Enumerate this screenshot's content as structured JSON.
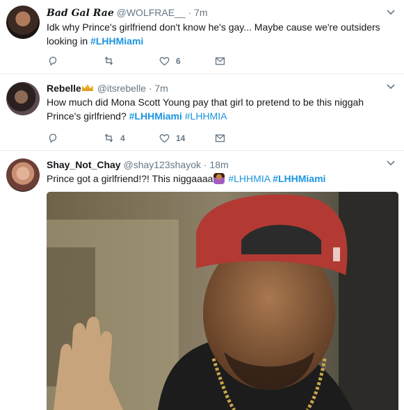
{
  "tweets": [
    {
      "name": "Bad Gal Rae",
      "handle": "@WOLFRAE__ · 7m",
      "text": [
        {
          "t": "Idk why "
        },
        {
          "t": "Prince",
          "b": true
        },
        {
          "t": "'s "
        },
        {
          "t": "girlfriend",
          "b": true
        },
        {
          "t": " don't know he's gay... Maybe cause we're outsiders looking in  "
        },
        {
          "t": "#LHHMiami",
          "tag": true,
          "b": true
        }
      ],
      "reply_count": "",
      "retweet_count": "",
      "like_count": "6"
    },
    {
      "name": "Rebelle",
      "handle": "@itsrebelle · 7m",
      "text": [
        {
          "t": "How much did Mona Scott Young pay that girl to pretend to be this niggah "
        },
        {
          "t": "Prince",
          "b": true
        },
        {
          "t": "'s "
        },
        {
          "t": "girlfriend",
          "b": true
        },
        {
          "t": "? "
        },
        {
          "t": "#LHHMiami",
          "tag": true,
          "b": true
        },
        {
          "t": " "
        },
        {
          "t": "#LHHMIA",
          "tag": true
        }
      ],
      "reply_count": "",
      "retweet_count": "4",
      "like_count": "14"
    },
    {
      "name": "Shay_Not_Chay",
      "handle": "@shay123shayok · 18m",
      "text": [
        {
          "t": "Prince",
          "b": true
        },
        {
          "t": " got a "
        },
        {
          "t": "girlfriend",
          "b": true
        },
        {
          "t": "!?! This niggaaaa"
        },
        {
          "emoji": "woman-shrugging"
        },
        {
          "t": " "
        },
        {
          "t": "#LHHMIA",
          "tag": true
        },
        {
          "t": " "
        },
        {
          "t": "#LHHMiami",
          "tag": true,
          "b": true
        }
      ]
    }
  ],
  "colors": {
    "link": "#1b95e0",
    "secondary": "#657786",
    "divider": "#e6ecf0"
  }
}
